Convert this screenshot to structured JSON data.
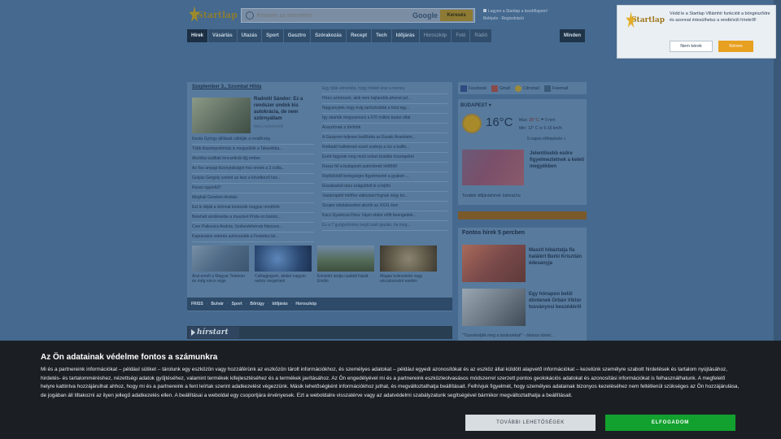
{
  "header": {
    "logo_text": "Startlap",
    "search": {
      "placeholder": "Keresés az interneten",
      "provider": "Google",
      "button_label": "Keresés"
    },
    "links": [
      "Legyen a Startlap a kezdőlapom!",
      "Belépés",
      "Regisztráció"
    ]
  },
  "nav": {
    "items": [
      "Hírek",
      "Vásárlás",
      "Utazás",
      "Sport",
      "Gasztro",
      "Szórakozás",
      "Recept",
      "Tech",
      "Időjárás",
      "Horoszkóp",
      "Fotó",
      "Rádió"
    ],
    "active": "Hírek",
    "more_label": "Minden"
  },
  "news": {
    "date": "Szeptember 3., Szombat",
    "nameday": "Hilda",
    "featured": {
      "title": "Radnóti Sándor: Ez a rendszer undok kis autokrácia, de nem szörnyállam",
      "source": "telex.hu/szerzők"
    },
    "left_items": [
      "Korda György állítását cáfolják a rendőrség",
      "Több klasztepolémiás is megszűnik a Takarékba...",
      "Akcióba szálltak lencsetinál díjj ember",
      "Az ősz anyagi bizonytalságot hoz ennek a 3 csilla...",
      "Gulyás Gergely szerint az lesz a következő hón...",
      "Russz egyedül?",
      "Meghalt Gerebén András",
      "Ezt is látják a drónnal lenézzük magyar rendőrök",
      "Belehalt sérüléseibe a muszterl Pride-on bántot...",
      "Czer Palkovics András, Székesfehérvár fideszes...",
      "Kaprázatos veterán autócsodák a Festetics bir..."
    ],
    "right_items": [
      "Egy díák elmondta, hogy miéért lesz a menza",
      "Híres színészek, akik nem hajlandók pihenni jel...",
      "Nagyanyánk négy évig tartózkodták a hóst egy...",
      "Így akarták megszerezni a 670 milliós budai villát",
      "Árasztónak a töröttök",
      "A Gazprom teljesen leállította az Északi Áramlatot...",
      "Rothadó halletenek ezzel sodorja a víz a kalifo...",
      "Ezért fagynak meg most sokan brutális összegeket",
      "Russz fél a budapesti autóroknek hétfőtől",
      "Rejtőzködő betegségre figyelmeztet a gyakori ...",
      "Elszabadult daru száguldott le a lejtőn",
      "Vasárnaptól hétfőre változtani fognak négy bo...",
      "Szuper iskolakezdési akciók az XXXL-ben",
      "Kacz Gyarkcza Dóra: Vajon ekkor előtt beengedek...",
      "Ez a 7 gyógynövény segít csak igazán, ha meg..."
    ],
    "thumbs": [
      {
        "caption": "Arat emelt a Magyar Telekom és még nincs vége"
      },
      {
        "caption": "Csillagjegyek, akiket nagyon nehéz megérteni"
      },
      {
        "caption": "Ennyiért árulja családi házát Emilio"
      },
      {
        "caption": "Magas koleszterin vagy vércukorszint esetén"
      }
    ],
    "bottom_tabs": [
      "FRISS",
      "Bulvár",
      "Sport",
      "Bőrügy",
      "Időjárás",
      "Horoszkóp"
    ]
  },
  "hirstart": {
    "logo_text": "hírstart"
  },
  "sidebar": {
    "social": [
      "Facebook",
      "Gmail",
      "Citromail",
      "Freemail"
    ],
    "weather": {
      "city": "BUDAPEST",
      "temp": "16°C",
      "max_label": "Max:",
      "max_temp": "25° C",
      "min_label": "Min:",
      "min_temp": "12° C",
      "rain": "0 mm",
      "wind": "5-15 km/h",
      "more_label": "5 napos előrejelzés »",
      "feature": "Jelentősebb esőre figyelmeztetnek a keleti megyékben",
      "link": "További időjáráshírek: koloral.hu"
    },
    "five_min": {
      "title": "Fontos hírek 5 percben",
      "item1": "Maszit hibáztatja fia halálért Berki Krisztián édesanyja",
      "item2": "Egy hónapon belül döntenek Orbán Viktor tusványosi beszédéről",
      "quote": "\"Tüzeskedjék meg a tanárainkat!\" - óriásos tüntet..."
    }
  },
  "popup": {
    "logo_text": "Startlap",
    "text": "Védd le a Startlap Villámhír funkcióit a böngésződre és azonnal értesülhetsz a rendkívüli hírekről!",
    "no_label": "Nem kérek",
    "yes_label": "Kérem"
  },
  "cookie": {
    "title": "Az Ön adatainak védelme fontos a számunkra",
    "text": "Mi és a partnereink információkat – például sütiket – tárolunk egy eszközön vagy hozzáférünk az eszközön tárolt információkhoz, és személyes adatokat – például egyedi azonosítókat és az eszköz által küldött alapvető információkat – kezelünk személyre szabott hirdetések és tartalom nyújtásához, hirdetés- és tartalomméréshez, nézettségi adatok gyűjtéséhez, valamint termékek kifejlesztéséhez és a termékek javításához. Az Ön engedélyével mi és a partnereink eszközleolvasásos módszerrel szerzett pontos geolokációs adatokat és azonosítási információkat is felhasználhatunk. A megfelelő helyre kattintva hozzájárulhat ahhoz, hogy mi és a partnereink a fent leírtak szerint adatkezelést végezzünk. Másik lehetőségként információkhoz juthat, és megváltoztathatja beállításait. Felhívjuk figyelmét, hogy személyes adatainak bizonyos kezeléséhez nem feltétlenül szükséges az Ön hozzájárulása, de jogában áll tiltakozni az ilyen jellegű adatkezelés ellen. A beállításai a weboldal egy csoportjára érvényesek. Ezt a weboldalre visszatérve vagy az adatvédelmi szabályzatunk segítségével bármikor megváltoztathatja a beállításait.",
    "more_label": "TOVÁBBI LEHETŐSÉGEK",
    "accept_label": "ELFOGADOM"
  },
  "colors": {
    "accept": "#12a12e",
    "popup_yes": "#e8a020",
    "overlay": "#3f5f82"
  }
}
